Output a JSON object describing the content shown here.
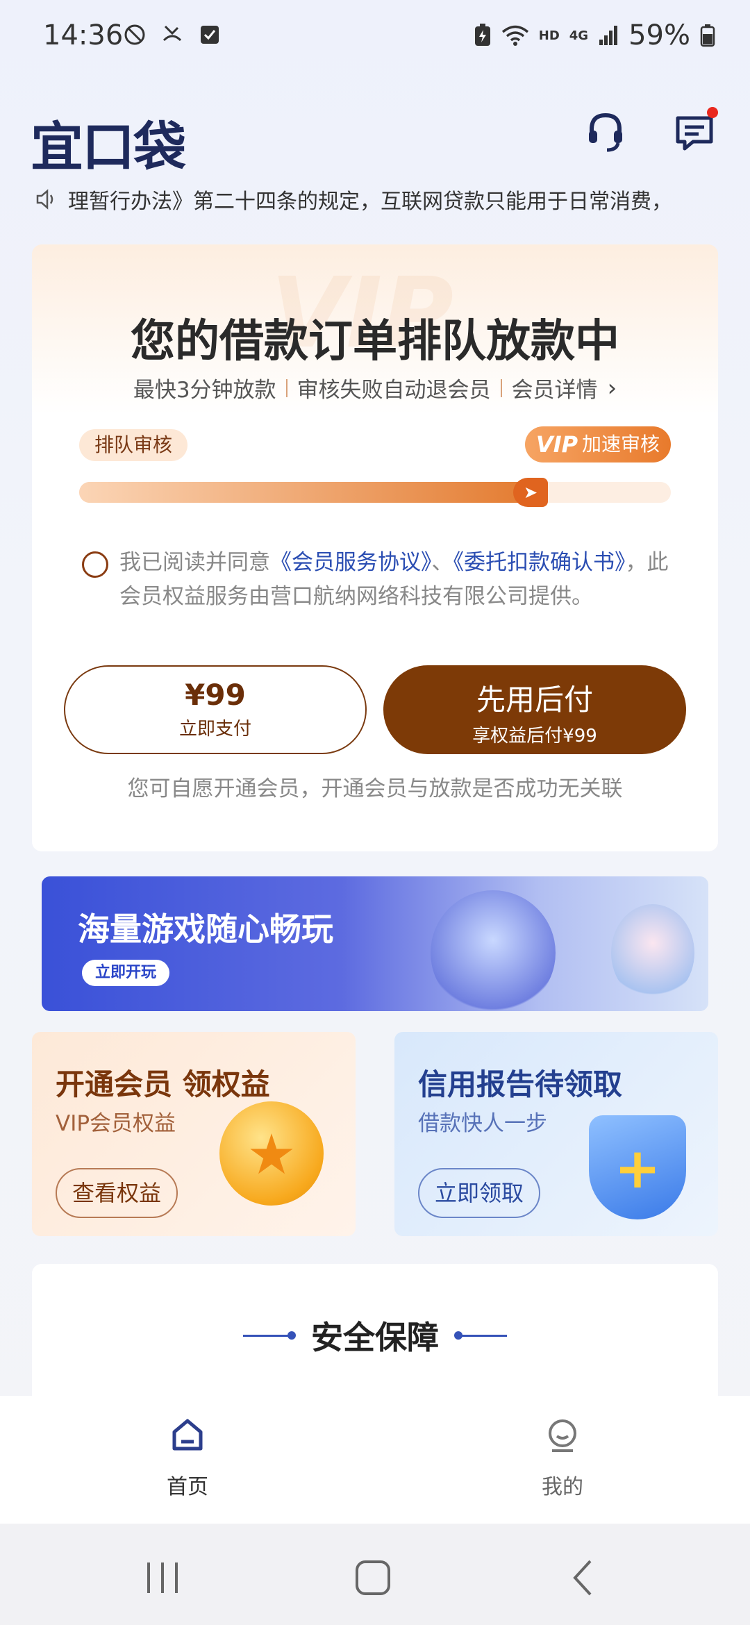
{
  "status_bar": {
    "time": "14:36",
    "battery": "59%",
    "network": "HD",
    "signal_label": "4G"
  },
  "header": {
    "logo": "宜口袋",
    "support_icon": "headset-icon",
    "message_icon": "message-icon",
    "message_badge": true
  },
  "ticker": {
    "icon": "speaker-icon",
    "text": "理暂行办法》第二十四条的规定，互联网贷款只能用于日常消费，"
  },
  "order_card": {
    "watermark": "VIP",
    "title": "您的借款订单排队放款中",
    "features": [
      "最快3分钟放款",
      "审核失败自动退会员",
      "会员详情"
    ],
    "queue_tag": "排队审核",
    "vip_badge_vip": "VIP",
    "vip_badge_label": "加速审核",
    "progress": 0.78,
    "agreement": {
      "prefix": "我已阅读并同意",
      "link1": "《会员服务协议》",
      "separator": "、",
      "link2": "《委托扣款确认书》",
      "suffix": "，此会员权益服务由营口航纳网络科技有限公司提供。"
    },
    "pay_now_price": "¥99",
    "pay_now_label": "立即支付",
    "pay_later_title": "先用后付",
    "pay_later_label": "享权益后付¥99",
    "disclaimer": "您可自愿开通会员，开通会员与放款是否成功无关联"
  },
  "game_banner": {
    "title": "海量游戏随心畅玩",
    "button": "立即开玩"
  },
  "promo_vip": {
    "title": "开通会员 领权益",
    "subtitle": "VIP会员权益",
    "button": "查看权益"
  },
  "promo_credit": {
    "title": "信用报告待领取",
    "subtitle": "借款快人一步",
    "button": "立即领取"
  },
  "security": {
    "title": "安全保障"
  },
  "tabs": [
    {
      "label": "首页",
      "icon": "home-icon",
      "active": true
    },
    {
      "label": "我的",
      "icon": "profile-icon",
      "active": false
    }
  ],
  "colors": {
    "brand_dark": "#1e2a5c",
    "accent_brown": "#7d3a07",
    "accent_orange": "#e37a2e",
    "link_blue": "#2a4db2"
  }
}
